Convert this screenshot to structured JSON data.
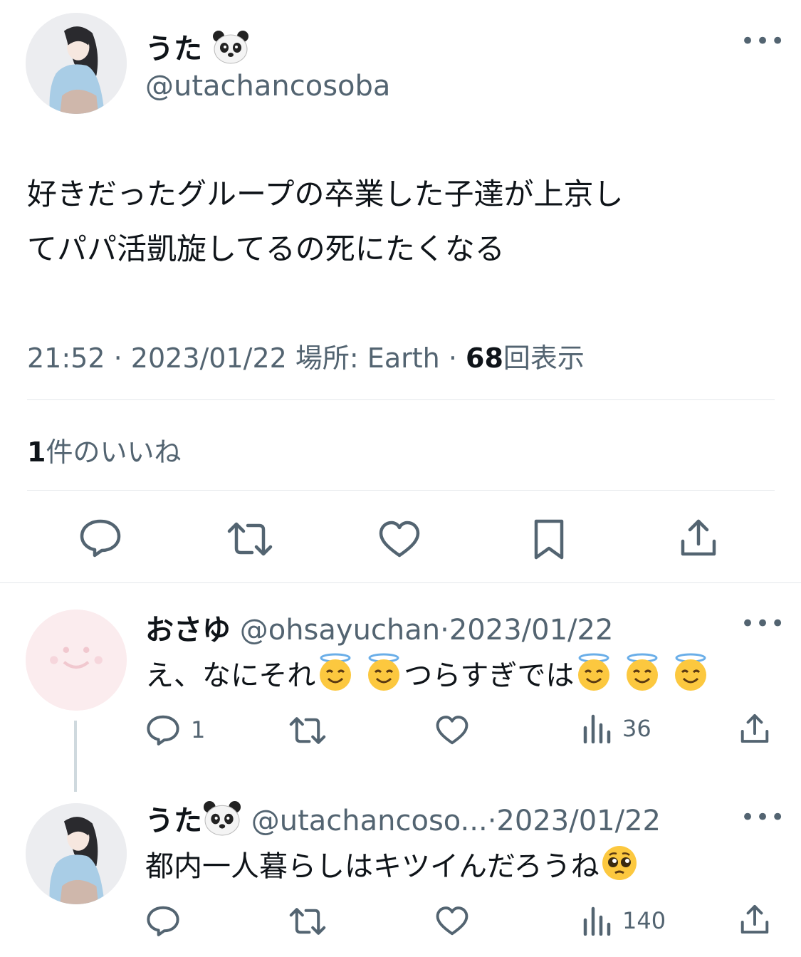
{
  "main_tweet": {
    "display_name": "うた",
    "name_emoji": "panda-emoji",
    "handle": "@utachancosoba",
    "more_label": "•••",
    "text_line1": "好きだったグループの卒業した子達が上京し",
    "text_line2": "てパパ活凱旋してるの死にたくなる",
    "time": "21:52",
    "sep1": "·",
    "date": "2023/01/22",
    "location_label": "場所: Earth",
    "sep2": "·",
    "views_count": "68",
    "views_label": "回表示",
    "likes_count": "1",
    "likes_label": "件のいいね",
    "actions": [
      "reply-icon",
      "retweet-icon",
      "like-icon",
      "bookmark-icon",
      "share-icon"
    ]
  },
  "replies": [
    {
      "display_name": "おさゆ",
      "handle": "@ohsayuchan",
      "sep": "·",
      "date": "2023/01/22",
      "more_label": "•••",
      "text_a": "え、なにそれ",
      "text_b": "つらすぎでは",
      "emoji": "smiling-face-with-halo-emoji",
      "reply_count": "1",
      "views_count": "36"
    },
    {
      "display_name": "うた",
      "name_emoji": "panda-emoji",
      "handle": "@utachancoso...",
      "sep": "·",
      "date": "2023/01/22",
      "more_label": "•••",
      "text": "都内一人暮らしはキツイんだろうね",
      "emoji": "pleading-face-emoji",
      "views_count": "140"
    }
  ],
  "colors": {
    "text_primary": "#0f1419",
    "text_secondary": "#536471",
    "divider": "#e4e8eb",
    "thread_line": "#cfd9de"
  }
}
